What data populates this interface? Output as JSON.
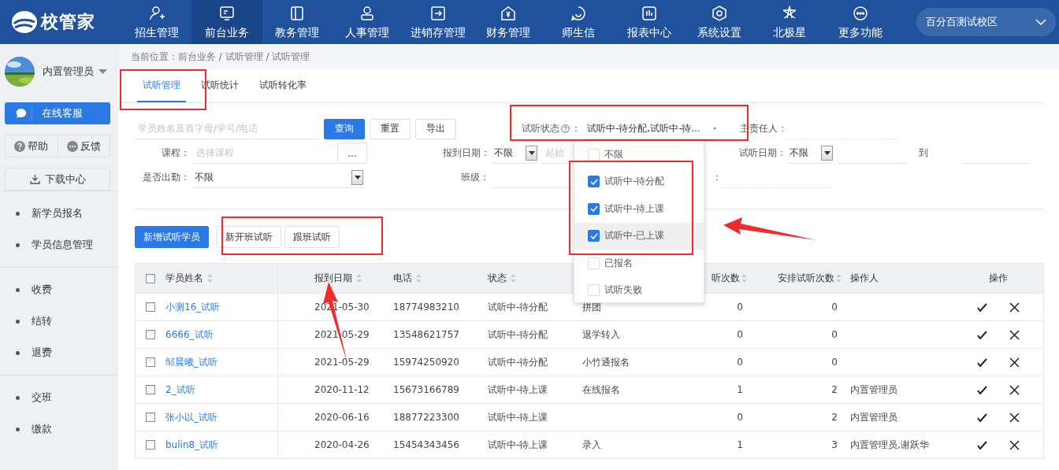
{
  "header": {
    "logo": "校管家",
    "campus": "百分百测试校区",
    "nav": [
      {
        "label": "招生管理",
        "selected": false
      },
      {
        "label": "前台业务",
        "selected": true
      },
      {
        "label": "教务管理",
        "selected": false
      },
      {
        "label": "人事管理",
        "selected": false
      },
      {
        "label": "进销存管理",
        "selected": false
      },
      {
        "label": "财务管理",
        "selected": false
      },
      {
        "label": "师生信",
        "selected": false
      },
      {
        "label": "报表中心",
        "selected": false
      },
      {
        "label": "系统设置",
        "selected": false
      },
      {
        "label": "北极星",
        "selected": false
      },
      {
        "label": "更多功能",
        "selected": false
      }
    ]
  },
  "sidebar": {
    "user": "内置管理员",
    "service_button": "在线客服",
    "help": "帮助",
    "feedback": "反馈",
    "download": "下载中心",
    "groups": [
      [
        "新学员报名",
        "学员信息管理"
      ],
      [
        "收费",
        "结转",
        "退费"
      ],
      [
        "交班",
        "缴款"
      ]
    ]
  },
  "breadcrumb": "当前位置：前台业务 / 试听管理 / 试听管理",
  "tabs": [
    {
      "label": "试听管理",
      "selected": true
    },
    {
      "label": "试听统计",
      "selected": false
    },
    {
      "label": "试听转化率",
      "selected": false
    }
  ],
  "search": {
    "placeholder": "学员姓名及首字母/学号/电话"
  },
  "actions": [
    {
      "label": "查询",
      "primary": true
    },
    {
      "label": "重置",
      "primary": false
    },
    {
      "label": "导出",
      "primary": false
    }
  ],
  "status_filter": {
    "label": "试听状态",
    "colon": "：",
    "value": "试听中-待分配,试听中-待...",
    "options": [
      {
        "label": "不限",
        "checked": false,
        "highlighted": false
      },
      {
        "label": "试听中-待分配",
        "checked": true,
        "highlighted": false
      },
      {
        "label": "试听中-待上课",
        "checked": true,
        "highlighted": false
      },
      {
        "label": "试听中-已上课",
        "checked": true,
        "highlighted": true
      },
      {
        "label": "已报名",
        "checked": false,
        "highlighted": false
      },
      {
        "label": "试听失败",
        "checked": false,
        "highlighted": false
      }
    ]
  },
  "owner": {
    "label": "主责任人："
  },
  "course": {
    "label": "课程：",
    "placeholder": "选择课程",
    "browse": "..."
  },
  "checkin_date": {
    "label": "报到日期：",
    "mode": "不限",
    "start_placeholder": "起始"
  },
  "trial_date": {
    "label": "试听日期：",
    "mode": "不限",
    "to": "到"
  },
  "attendance": {
    "label": "是否出勤：",
    "value": "不限"
  },
  "class_filter": {
    "label": "班级："
  },
  "hidden_filter": {
    "label_tail": "："
  },
  "toolbar": [
    {
      "label": "新增试听学员",
      "primary": true
    },
    {
      "label": "新开班试听",
      "primary": false
    },
    {
      "label": "跟班试听",
      "primary": false
    }
  ],
  "table": {
    "all_checked": false,
    "columns": [
      {
        "label": "学员姓名",
        "sortable": true
      },
      {
        "label": "报到日期",
        "sortable": true
      },
      {
        "label": "电话",
        "sortable": true
      },
      {
        "label": "状态",
        "sortable": true
      },
      {
        "label": "听次数",
        "sortable": true
      },
      {
        "label": "安排试听次数",
        "sortable": true
      },
      {
        "label": "操作人",
        "sortable": false
      },
      {
        "label": "操作",
        "sortable": false
      }
    ],
    "rows": [
      {
        "checked": false,
        "name": "小测16_试听",
        "date": "2021-05-30",
        "phone": "18774983210",
        "status": "试听中-待分配",
        "column_5": "拼团",
        "trials": "0",
        "arranged": "0"
      },
      {
        "checked": false,
        "name": "6666_试听",
        "date": "2021-05-29",
        "phone": "13548621757",
        "status": "试听中-待分配",
        "column_5": "退学转入",
        "trials": "0",
        "arranged": "0"
      },
      {
        "checked": false,
        "name": "邹晨曦_试听",
        "date": "2021-05-29",
        "phone": "15974250920",
        "status": "试听中-待分配",
        "column_5": "小竹通报名",
        "trials": "0",
        "arranged": "0"
      },
      {
        "checked": false,
        "name": "2_试听",
        "date": "2020-11-12",
        "phone": "15673166789",
        "status": "试听中-待上课",
        "column_5": "在线报名",
        "trials": "1",
        "arranged": "2",
        "operator": "内置管理员"
      },
      {
        "checked": false,
        "name": "张小以_试听",
        "date": "2020-06-16",
        "phone": "18877223300",
        "status": "试听中-待上课",
        "trials": "0",
        "arranged": "2",
        "operator": "内置管理员"
      },
      {
        "checked": false,
        "name": "bulin8_试听",
        "date": "2020-04-26",
        "phone": "15454343456",
        "status": "试听中-待上课",
        "column_5": "录入",
        "trials": "1",
        "arranged": "3",
        "operator": "内置管理员,谢跃华"
      }
    ]
  }
}
